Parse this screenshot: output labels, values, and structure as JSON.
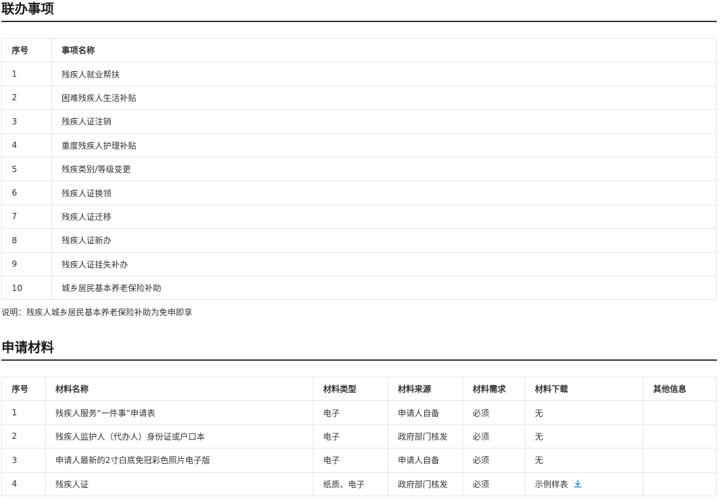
{
  "sections": {
    "lianban_title": "联办事项",
    "materials_title": "申请材料"
  },
  "items_table": {
    "headers": {
      "index": "序号",
      "name": "事项名称"
    },
    "rows": [
      {
        "index": "1",
        "name": "残疾人就业帮扶"
      },
      {
        "index": "2",
        "name": "困难残疾人生活补贴"
      },
      {
        "index": "3",
        "name": "残疾人证注销"
      },
      {
        "index": "4",
        "name": "重度残疾人护理补贴"
      },
      {
        "index": "5",
        "name": "残疾类别/等级变更"
      },
      {
        "index": "6",
        "name": "残疾人证换领"
      },
      {
        "index": "7",
        "name": "残疾人证迁移"
      },
      {
        "index": "8",
        "name": "残疾人证新办"
      },
      {
        "index": "9",
        "name": "残疾人证挂失补办"
      },
      {
        "index": "10",
        "name": "城乡居民基本养老保险补助"
      }
    ]
  },
  "note": "说明：残疾人城乡居民基本养老保险补助为免申即享",
  "materials_table": {
    "headers": {
      "index": "序号",
      "name": "材料名称",
      "type": "材料类型",
      "source": "材料来源",
      "requirement": "材料需求",
      "download": "材料下载",
      "other": "其他信息"
    },
    "rows": [
      {
        "index": "1",
        "name": "残疾人服务“一件事”申请表",
        "type": "电子",
        "source": "申请人自备",
        "requirement": "必须",
        "download": "无",
        "other": ""
      },
      {
        "index": "2",
        "name": "残疾人监护人（代办人）身份证或户口本",
        "type": "电子",
        "source": "政府部门核发",
        "requirement": "必须",
        "download": "无",
        "other": ""
      },
      {
        "index": "3",
        "name": "申请人最新的2寸白底免冠彩色照片电子版",
        "type": "电子",
        "source": "申请人自备",
        "requirement": "必须",
        "download": "无",
        "other": ""
      },
      {
        "index": "4",
        "name": "残疾人证",
        "type": "纸质、电子",
        "source": "政府部门核发",
        "requirement": "必须",
        "download": "示例样表",
        "other": ""
      }
    ]
  },
  "colors": {
    "download_icon": "#1e88e5",
    "border": "#e6e6e6",
    "title_rule": "#333333"
  },
  "icons": {
    "download": "download-icon"
  }
}
